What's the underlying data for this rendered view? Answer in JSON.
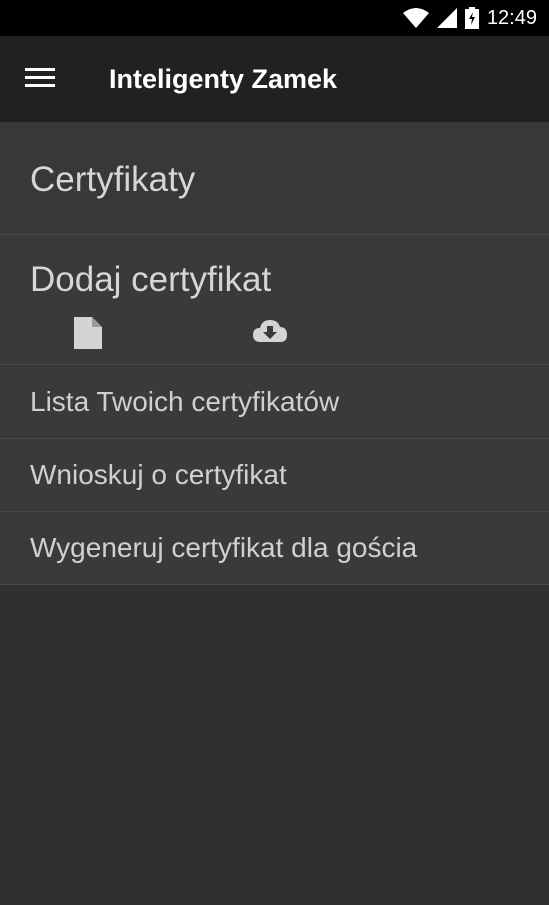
{
  "status_bar": {
    "time": "12:49"
  },
  "app_bar": {
    "title": "Inteligenty Zamek"
  },
  "certificates": {
    "title": "Certyfikaty"
  },
  "add_certificate": {
    "title": "Dodaj certyfikat"
  },
  "menu": [
    {
      "label": "Lista Twoich certyfikatów"
    },
    {
      "label": "Wnioskuj o certyfikat"
    },
    {
      "label": "Wygeneruj certyfikat dla gościa"
    }
  ],
  "colors": {
    "background": "#303030",
    "app_bar": "#212121",
    "status_bar": "#000000",
    "text": "#d0d0d0"
  },
  "icons": [
    "wifi-icon",
    "cell-signal-icon",
    "battery-charging-icon",
    "hamburger-menu-icon",
    "file-icon",
    "cloud-download-icon"
  ]
}
